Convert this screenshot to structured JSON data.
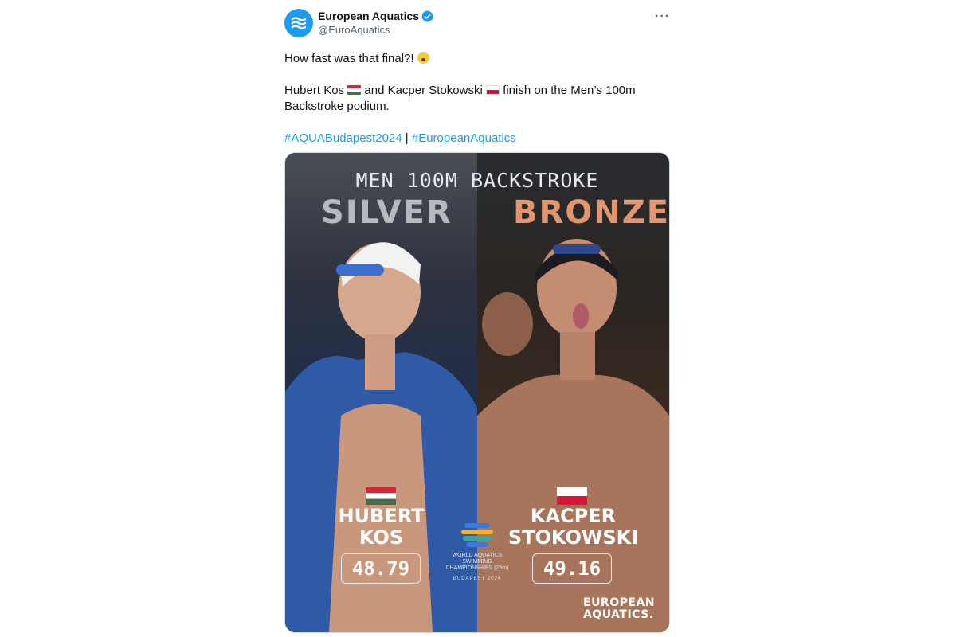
{
  "tweet": {
    "display_name": "European Aquatics",
    "handle": "@EuroAquatics",
    "verified": true,
    "more_icon": "more-horizontal-icon",
    "line1": "How fast was that final?!",
    "line2_a": "Hubert Kos",
    "line2_b": "and Kacper Stokowski",
    "line2_c": "finish on the Men’s 100m Backstroke podium.",
    "hashtag1": "#AQUABudapest2024",
    "separator": "|",
    "hashtag2": "#EuropeanAquatics"
  },
  "graphic": {
    "heading": "MEN 100M BACKSTROKE",
    "silver_label": "SILVER",
    "bronze_label": "BRONZE",
    "left_name_1": "HUBERT",
    "left_name_2": "KOS",
    "right_name_1": "KACPER",
    "right_name_2": "STOKOWSKI",
    "left_time": "48.79",
    "right_time": "49.16",
    "event_logo_line1": "WORLD AQUATICS",
    "event_logo_line2": "SWIMMING",
    "event_logo_line3": "CHAMPIONSHIPS (25m)",
    "event_logo_city": "BUDAPEST 2024",
    "brand_line1": "EUROPEAN",
    "brand_line2": "AQUATICS."
  },
  "colors": {
    "link": "#1d9bf0",
    "silver": "#b7b9bd",
    "bronze": "#e0966e"
  }
}
